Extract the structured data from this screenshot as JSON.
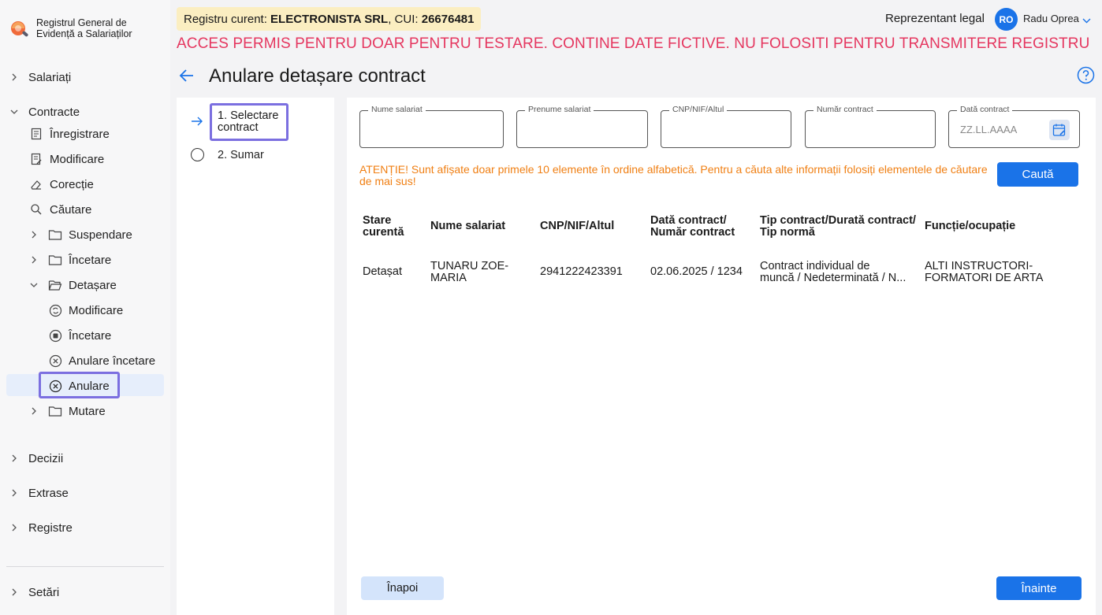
{
  "app": {
    "logo_text": "Registrul General de Evidență a Salariaților"
  },
  "header": {
    "registry_prefix": "Registru curent: ",
    "company_name": "ELECTRONISTA SRL",
    "cui_prefix": ", CUI: ",
    "cui": "26676481",
    "role": "Reprezentant legal",
    "avatar_initials": "RO",
    "user_name": "Radu Oprea",
    "warning": "ACCES PERMIS PENTRU DOAR PENTRU TESTARE. CONTINE DATE FICTIVE. NU FOLOSITI PENTRU TRANSMITERE REGISTRU"
  },
  "sidebar": {
    "salariati": "Salariați",
    "contracte": "Contracte",
    "inregistrare": "Înregistrare",
    "modificare": "Modificare",
    "corectie": "Corecție",
    "cautare": "Căutare",
    "suspendare": "Suspendare",
    "incetare": "Încetare",
    "detasare": "Detașare",
    "det_modificare": "Modificare",
    "det_incetare": "Încetare",
    "det_anulare_incetare": "Anulare încetare",
    "det_anulare": "Anulare",
    "mutare": "Mutare",
    "decizii": "Decizii",
    "extrase": "Extrase",
    "registre": "Registre",
    "setari": "Setări"
  },
  "page": {
    "title": "Anulare detașare contract"
  },
  "steps": [
    {
      "label": "1. Selectare contract",
      "active": true
    },
    {
      "label": "2. Sumar",
      "active": false
    }
  ],
  "filters": {
    "nume_label": "Nume salariat",
    "nume_value": "",
    "prenume_label": "Prenume salariat",
    "prenume_value": "",
    "cnp_label": "CNP/NIF/Altul",
    "cnp_value": "",
    "numar_label": "Număr contract",
    "numar_value": "",
    "data_label": "Dată contract",
    "data_placeholder": "ZZ.LL.AAAA"
  },
  "attention": "ATENȚIE! Sunt afișate doar primele 10 elemente în ordine alfabetică. Pentru a căuta alte informații folosiți elementele de căutare de mai sus!",
  "search_button": "Caută",
  "table": {
    "headers": {
      "stare_1": "Stare",
      "stare_2": "curentă",
      "nume": "Nume salariat",
      "cnp": "CNP/NIF/Altul",
      "data_1": "Dată contract/",
      "data_2": "Număr contract",
      "tip_1": "Tip contract/Durată contract/",
      "tip_2": "Tip normă",
      "functie": "Funcție/ocupație"
    },
    "rows": [
      {
        "stare": "Detașat",
        "nume_1": "TUNARU ZOE-",
        "nume_2": "MARIA",
        "cnp": "2941222423391",
        "data": "02.06.2025 / 1234",
        "tip_1": "Contract individual de",
        "tip_2": "muncă / Nedeterminată / N...",
        "functie_1": "ALTI INSTRUCTORI-",
        "functie_2": "FORMATORI DE ARTA"
      }
    ]
  },
  "footer": {
    "back": "Înapoi",
    "next": "Înainte"
  },
  "colors": {
    "accent": "#1a73e8",
    "warning": "#e5365f",
    "attention": "#f07f13",
    "highlight": "#7b6fe0"
  }
}
